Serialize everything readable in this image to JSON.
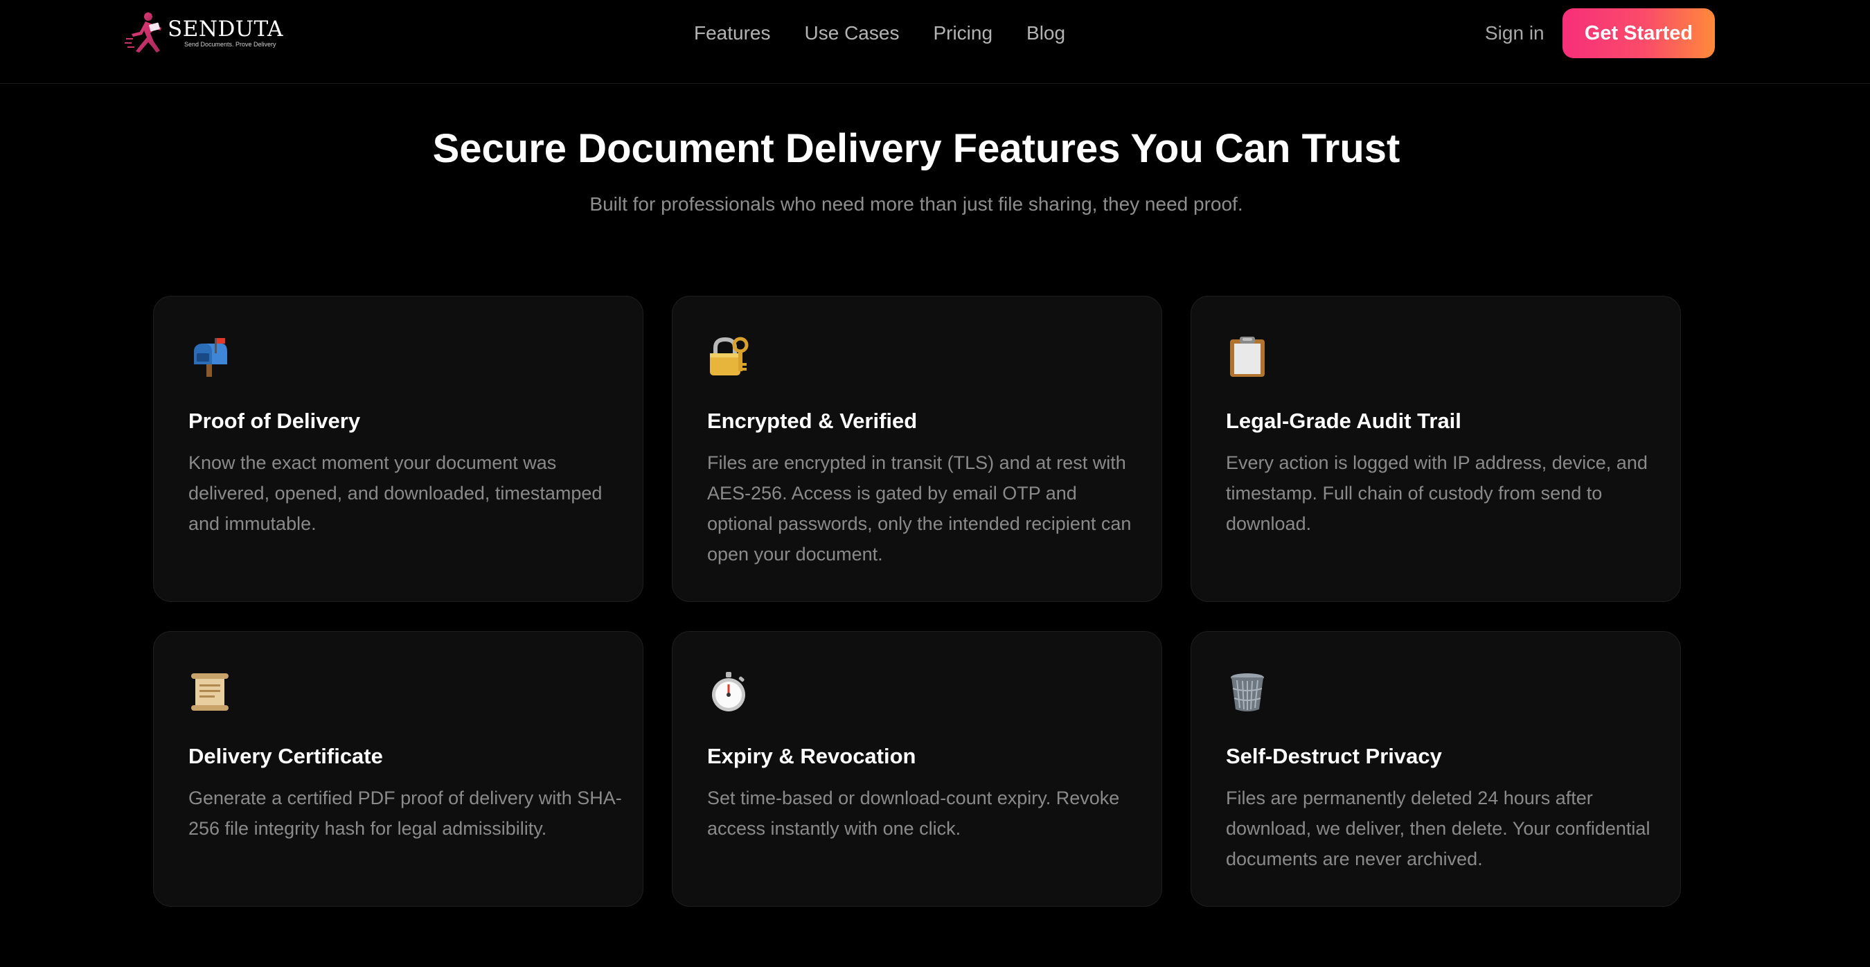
{
  "header": {
    "logo": {
      "name": "SENDUTA",
      "tagline": "Send Documents. Prove Delivery"
    },
    "nav": [
      "Features",
      "Use Cases",
      "Pricing",
      "Blog"
    ],
    "sign_in": "Sign in",
    "cta": "Get Started"
  },
  "hero": {
    "title": "Secure Document Delivery Features You Can Trust",
    "subtitle": "Built for professionals who need more than just file sharing, they need proof."
  },
  "features": [
    {
      "icon": "mailbox-icon",
      "title": "Proof of Delivery",
      "description": "Know the exact moment your document was delivered, opened, and downloaded, timestamped and immutable."
    },
    {
      "icon": "lock-with-key-icon",
      "title": "Encrypted & Verified",
      "description": "Files are encrypted in transit (TLS) and at rest with AES-256. Access is gated by email OTP and optional passwords, only the intended recipient can open your document."
    },
    {
      "icon": "clipboard-icon",
      "title": "Legal-Grade Audit Trail",
      "description": "Every action is logged with IP address, device, and timestamp. Full chain of custody from send to download."
    },
    {
      "icon": "scroll-icon",
      "title": "Delivery Certificate",
      "description": "Generate a certified PDF proof of delivery with SHA-256 file integrity hash for legal admissibility."
    },
    {
      "icon": "stopwatch-icon",
      "title": "Expiry & Revocation",
      "description": "Set time-based or download-count expiry. Revoke access instantly with one click."
    },
    {
      "icon": "wastebasket-icon",
      "title": "Self-Destruct Privacy",
      "description": "Files are permanently deleted 24 hours after download, we deliver, then delete. Your confidential documents are never archived."
    }
  ],
  "colors": {
    "background": "#000000",
    "card_background": "#0e0e0e",
    "cta_gradient_start": "#f72f7a",
    "cta_gradient_end": "#ff8a3a"
  }
}
